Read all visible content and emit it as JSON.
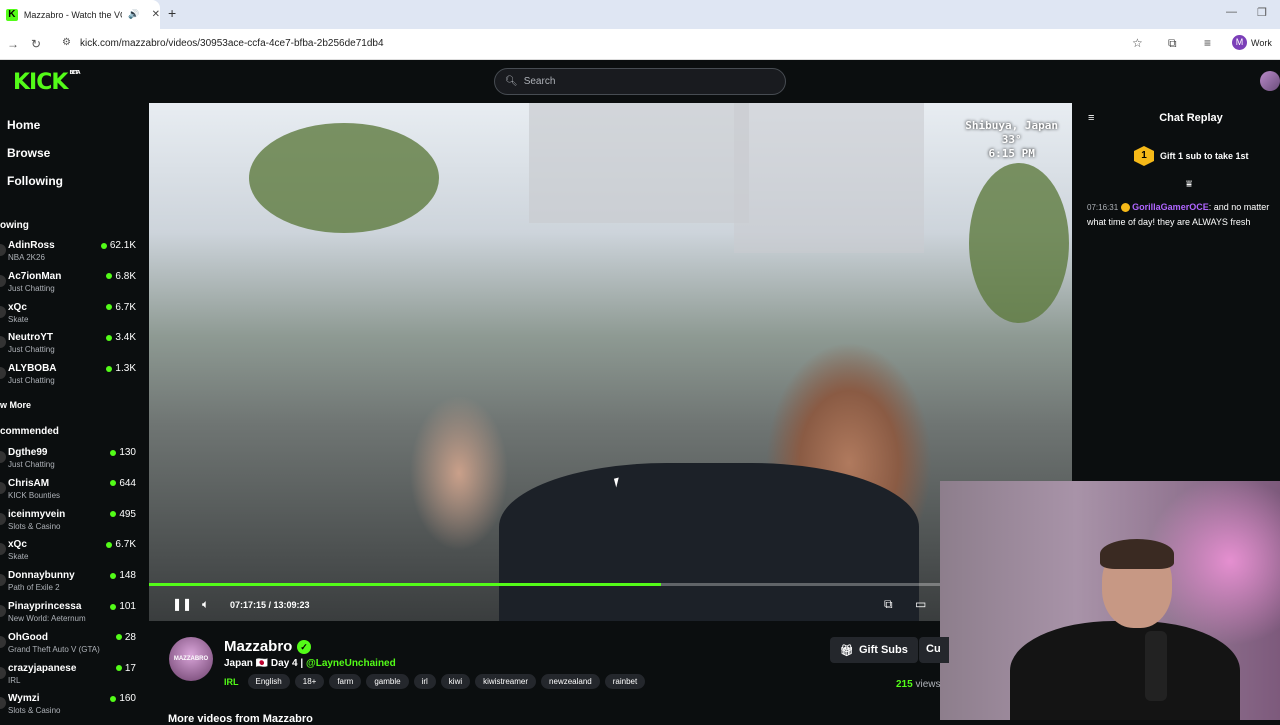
{
  "browser": {
    "tab_title": "Mazzabro - Watch the VOD",
    "url": "kick.com/mazzabro/videos/30953ace-ccfa-4ce7-bfba-2b256de71db4",
    "profile_label": "Work",
    "profile_initial": "M"
  },
  "header": {
    "logo": "KICK",
    "logo_badge": "BETA",
    "search_placeholder": "Search"
  },
  "sidebar": {
    "nav": [
      "Home",
      "Browse",
      "Following"
    ],
    "following_heading": "owing",
    "following": [
      {
        "name": "AdinRoss",
        "category": "NBA 2K26",
        "viewers": "62.1K"
      },
      {
        "name": "Ac7ionMan",
        "category": "Just Chatting",
        "viewers": "6.8K"
      },
      {
        "name": "xQc",
        "category": "Skate",
        "viewers": "6.7K"
      },
      {
        "name": "NeutroYT",
        "category": "Just Chatting",
        "viewers": "3.4K"
      },
      {
        "name": "ALYBOBA",
        "category": "Just Chatting",
        "viewers": "1.3K"
      }
    ],
    "show_more": "w More",
    "recommended_heading": "commended",
    "recommended": [
      {
        "name": "Dgthe99",
        "category": "Just Chatting",
        "viewers": "130"
      },
      {
        "name": "ChrisAM",
        "category": "KICK Bounties",
        "viewers": "644"
      },
      {
        "name": "iceinmyvein",
        "category": "Slots & Casino",
        "viewers": "495"
      },
      {
        "name": "xQc",
        "category": "Skate",
        "viewers": "6.7K"
      },
      {
        "name": "Donnaybunny",
        "category": "Path of Exile 2",
        "viewers": "148"
      },
      {
        "name": "Pinayprincessa",
        "category": "New World: Aeternum",
        "viewers": "101"
      },
      {
        "name": "OhGood",
        "category": "Grand Theft Auto V (GTA)",
        "viewers": "28"
      },
      {
        "name": "crazyjapanese",
        "category": "IRL",
        "viewers": "17"
      },
      {
        "name": "Wymzi",
        "category": "Slots & Casino",
        "viewers": "160"
      }
    ]
  },
  "video": {
    "overlay_location": "Shibuya, Japan",
    "overlay_temp": "33°",
    "overlay_time": "6:15 PM",
    "timecode": "07:17:15 / 13:09:23",
    "progress": 0.555
  },
  "chat": {
    "title": "Chat Replay",
    "gift_count": "1",
    "gift_text": "Gift 1 sub to take 1st",
    "messages": [
      {
        "time": "07:16:31",
        "user": "GorillaGamerOCE",
        "text": ": and no matter what time of day! they are ALWAYS fresh"
      }
    ]
  },
  "channel": {
    "avatar_text": "MAZZABRO",
    "name": "Mazzabro",
    "title_prefix": "Japan 🇯🇵 Day 4 | ",
    "title_mention": "@LayneUnchained",
    "category": "IRL",
    "tags": [
      "English",
      "18+",
      "farm",
      "gamble",
      "irl",
      "kiwi",
      "kiwistreamer",
      "newzealand",
      "rainbet"
    ],
    "gift_subs_label": "Gift Subs",
    "cut_button_label": "Cu",
    "views_count": "215",
    "views_label": " views",
    "more_videos": "More videos from Mazzabro"
  },
  "colors": {
    "accent": "#53fc18",
    "background": "#0b0e0f",
    "badge": "#f6b918",
    "chat_user": "#b066ff"
  }
}
